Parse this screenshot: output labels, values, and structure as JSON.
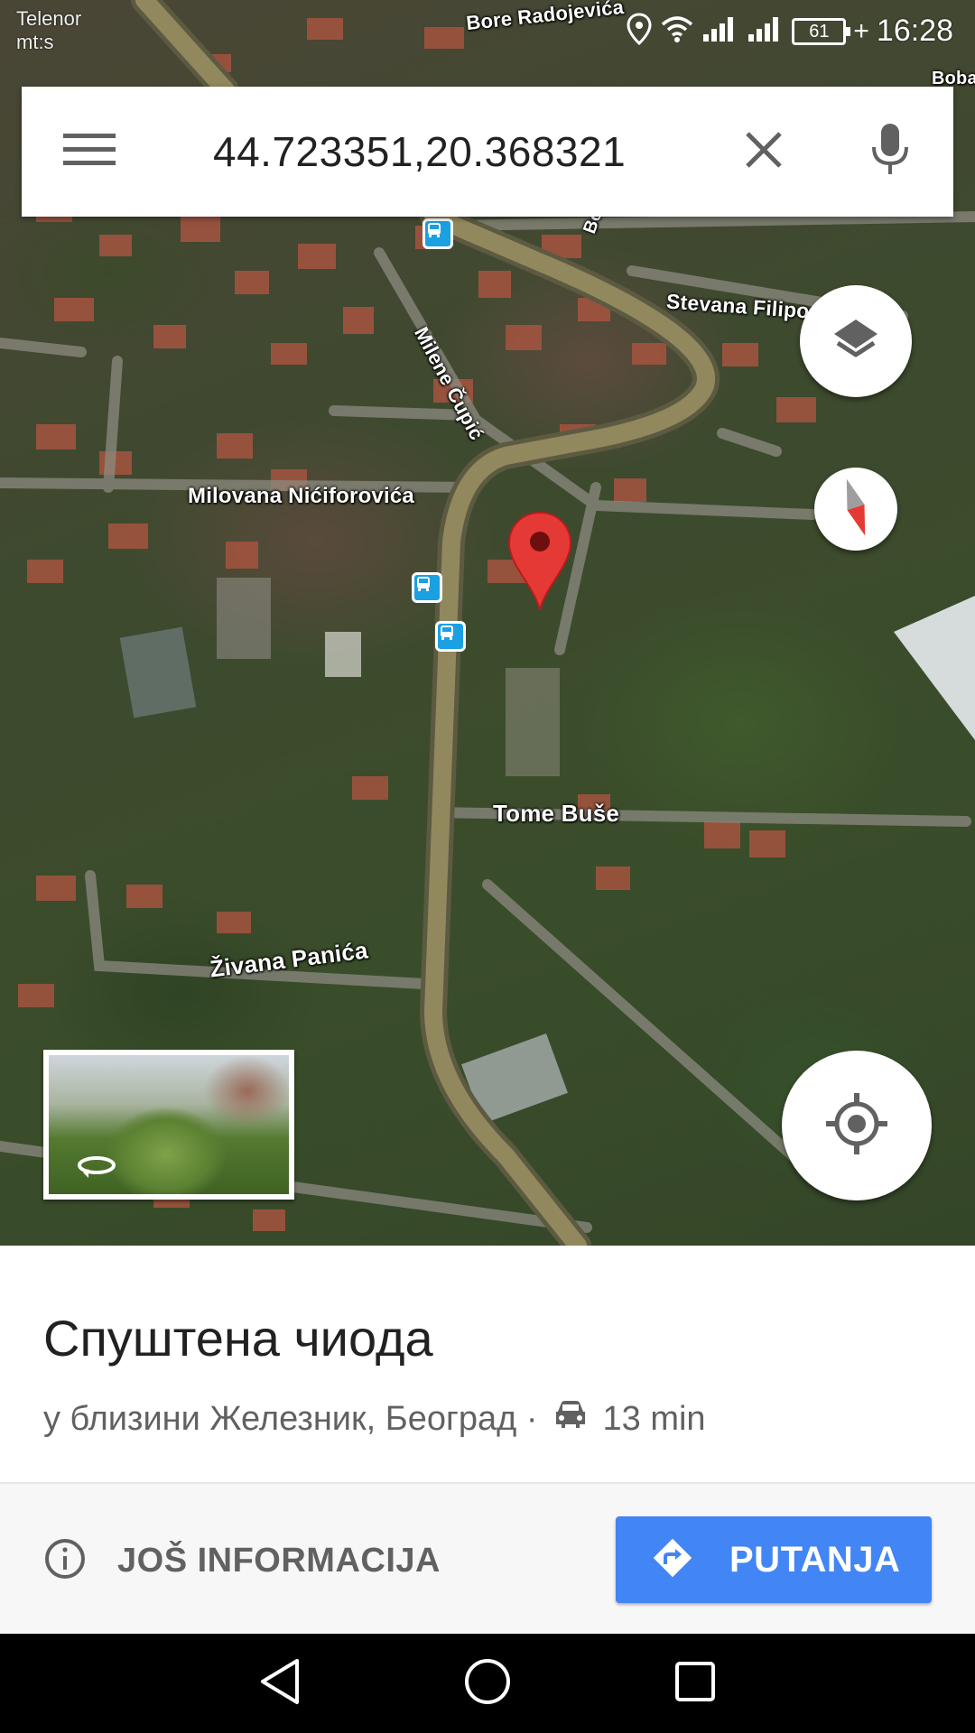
{
  "status_bar": {
    "carrier_line1": "Telenor",
    "carrier_line2": "mt:s",
    "battery": "61",
    "time": "16:28"
  },
  "search": {
    "value": "44.723351,20.368321"
  },
  "map": {
    "street_labels": {
      "bore_radojevica": "Bore Radojevića",
      "boba": "Boba",
      "stevana_filipo": "Stevana Filipo",
      "milene_cupic": "Milene Čupić",
      "milovana_niciforovica": "Milovana Nićiforovića",
      "tome_buse": "Tome Buše",
      "zivana_panica": "Živana Panića",
      "bo": "Bo"
    }
  },
  "place": {
    "title": "Спуштена чиода",
    "subtitle": "у близини Железник, Београд ·",
    "drive_time": "13 min"
  },
  "actions": {
    "more_info_label": "JOŠ INFORMACIJA",
    "directions_label": "PUTANJA"
  },
  "colors": {
    "accent_blue": "#4285f4",
    "pin_red": "#e53935",
    "bus_stop_blue": "#1ba0e2"
  },
  "icons": [
    "menu-icon",
    "close-icon",
    "mic-icon",
    "layers-icon",
    "compass-icon",
    "my-location-icon",
    "map-pin-icon",
    "bus-stop-icon",
    "street-view-icon",
    "car-icon",
    "info-icon",
    "directions-icon",
    "nav-back-icon",
    "nav-home-icon",
    "nav-recents-icon"
  ]
}
